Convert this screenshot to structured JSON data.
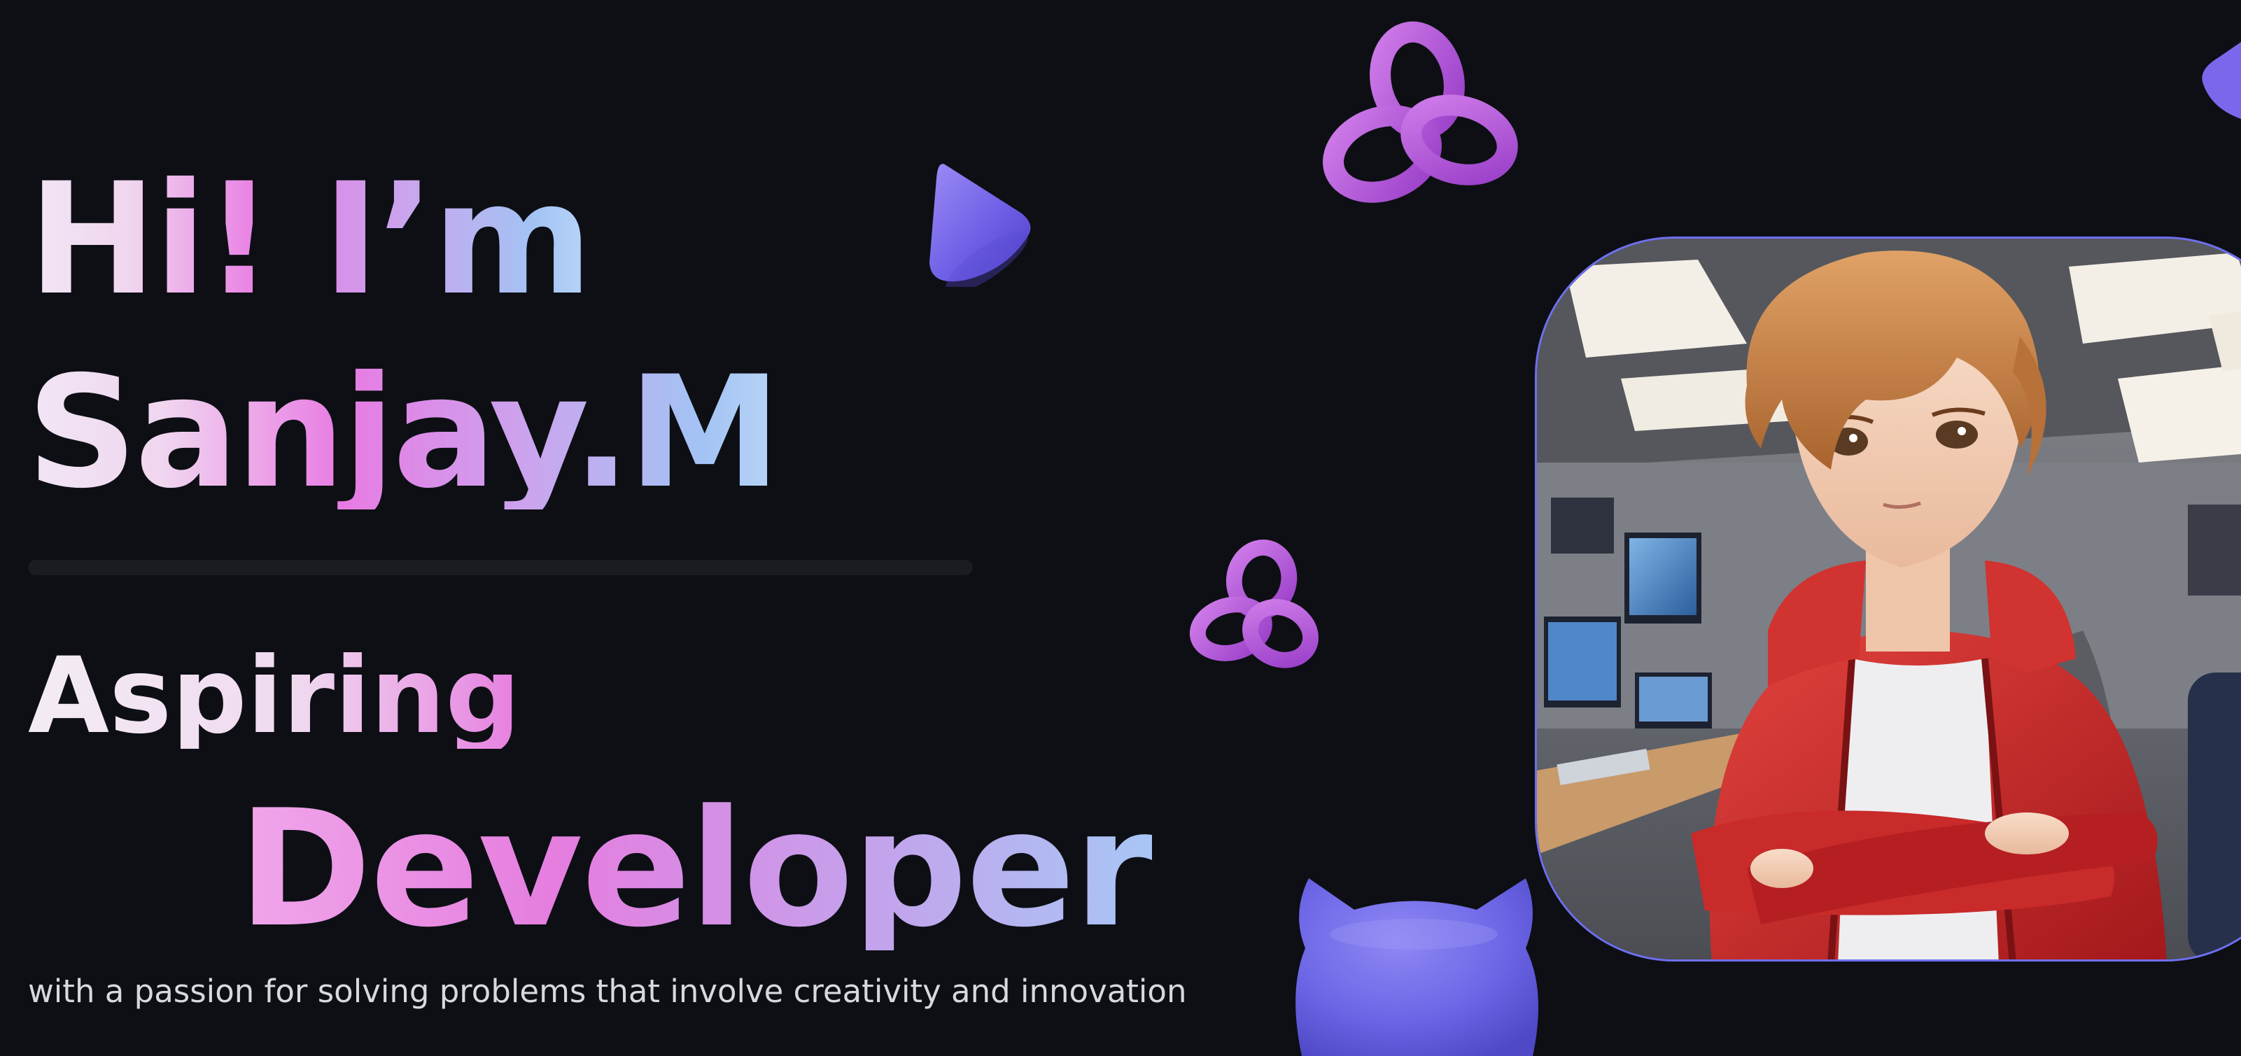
{
  "hero": {
    "greeting": "Hi! I’m",
    "name": "Sanjay.M",
    "role_line_1": "Aspiring",
    "role_line_2": "Developer",
    "tagline": "with a passion for solving problems that involve creativity and innovation"
  },
  "decorations": {
    "shapes": [
      "cone-icon",
      "trefoil-knot-icon",
      "cat-head-icon"
    ],
    "accent_color": "#7b6cf0",
    "purple_color": "#b45cd6"
  },
  "portrait": {
    "subject": "anime-style young man with orange hair in a red hoodie, arms crossed, in a computer lab"
  }
}
